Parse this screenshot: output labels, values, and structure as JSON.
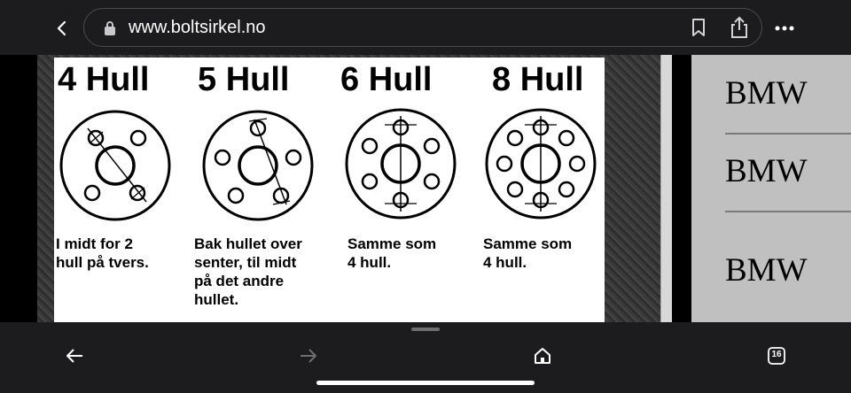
{
  "browser": {
    "url": "www.boltsirkel.no",
    "tab_count": "16"
  },
  "figure": {
    "columns": [
      {
        "heading": "4 Hull",
        "description": "I midt for 2\nhull på tvers."
      },
      {
        "heading": "5 Hull",
        "description": "Bak hullet over\nsenter, til midt\npå det andre\nhullet."
      },
      {
        "heading": "6 Hull",
        "description": "Samme som\n4 hull."
      },
      {
        "heading": "8 Hull",
        "description": "Samme som\n4 hull."
      }
    ]
  },
  "sidebar": {
    "items": [
      "BMW",
      "BMW",
      "BMW"
    ]
  },
  "colors": {
    "toolbar_bg": "#1c1c1e",
    "right_panel_bg": "#c0c0c0"
  },
  "icons": [
    "back-chevron-icon",
    "lock-icon",
    "bookmark-icon",
    "share-icon",
    "more-icon",
    "back-arrow-icon",
    "forward-arrow-icon",
    "home-icon",
    "tabs-icon"
  ]
}
